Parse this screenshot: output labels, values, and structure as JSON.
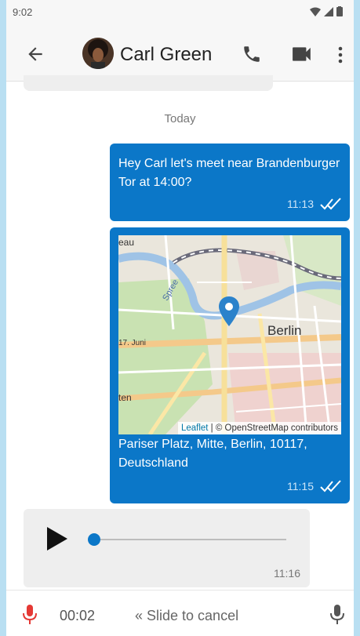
{
  "status_bar": {
    "time": "9:02",
    "icons": [
      "wifi-icon",
      "cell-signal-icon",
      "battery-icon"
    ]
  },
  "header": {
    "back_icon": "arrow-back-icon",
    "contact_name": "Carl Green",
    "call_icon": "phone-icon",
    "video_icon": "videocam-icon",
    "more_icon": "more-vert-icon"
  },
  "conversation": {
    "date_separator": "Today",
    "messages": [
      {
        "type": "text",
        "direction": "outgoing",
        "text": "Hey Carl let's meet near Brandenburger Tor at 14:00?",
        "time": "11:13",
        "status": "read"
      },
      {
        "type": "location",
        "direction": "outgoing",
        "map": {
          "labels": [
            "Berlin",
            "eau",
            "Spree",
            "17. Juni",
            "ten"
          ],
          "attribution_link": "Leaflet",
          "attribution_text": " | © OpenStreetMap contributors"
        },
        "address": "Pariser Platz, Mitte, Berlin, 10117, Deutschland",
        "time": "11:15",
        "status": "read"
      },
      {
        "type": "voice",
        "direction": "incoming",
        "progress": 0.0,
        "time": "11:16"
      }
    ]
  },
  "recording_bar": {
    "elapsed": "00:02",
    "hint": "« Slide to cancel"
  },
  "colors": {
    "accent": "#0b77c8",
    "record": "#e53935",
    "background": "#ffffff",
    "incoming_bubble": "#eeeeee"
  }
}
